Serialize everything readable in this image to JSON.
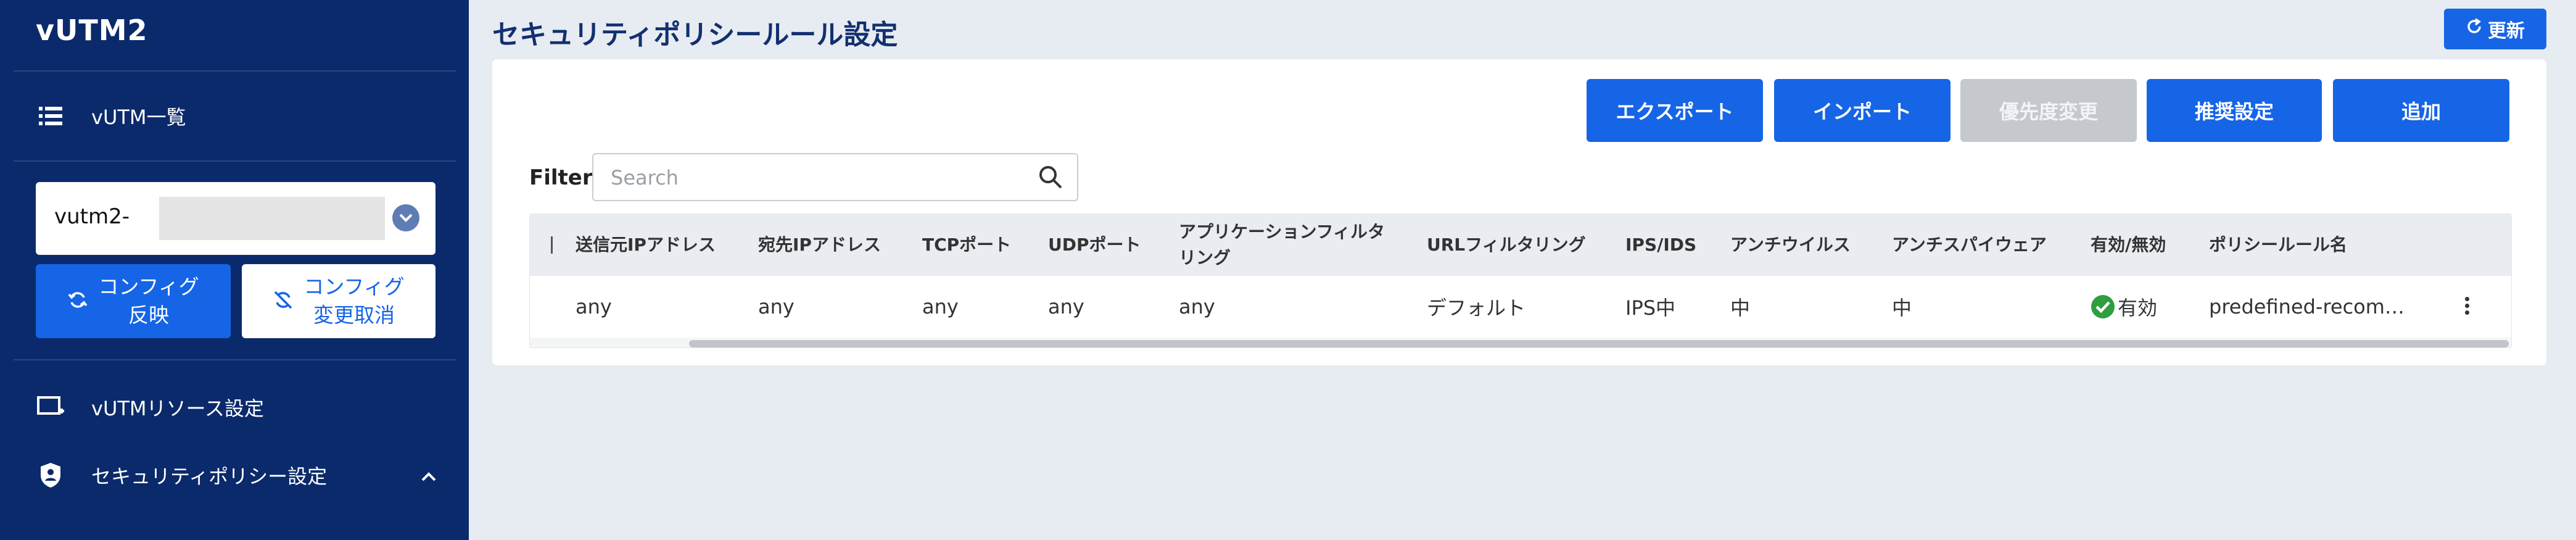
{
  "sidebar": {
    "brand": "vUTM2",
    "items": [
      {
        "label": "vUTM一覧",
        "icon": "list-icon"
      },
      {
        "label": "vUTMリソース設定",
        "icon": "add-screen-icon"
      },
      {
        "label": "セキュリティポリシー設定",
        "icon": "shield-icon"
      }
    ],
    "selector": {
      "value": "vutm2-"
    },
    "apply_button": "コンフィグ\n反映",
    "cancel_button": "コンフィグ\n変更取消"
  },
  "header": {
    "title": "セキュリティポリシールール設定",
    "refresh_label": "更新"
  },
  "toolbar": {
    "export": "エクスポート",
    "import": "インポート",
    "priority": "優先度変更",
    "recommended": "推奨設定",
    "add": "追加"
  },
  "filter": {
    "label": "Filter",
    "placeholder": "Search"
  },
  "table": {
    "columns": [
      "送信元IPアドレス",
      "宛先IPアドレス",
      "TCPポート",
      "UDPポート",
      "アプリケーションフィルタリング",
      "URLフィルタリング",
      "IPS/IDS",
      "アンチウイルス",
      "アンチスパイウェア",
      "有効/無効",
      "ポリシールール名"
    ],
    "rows": [
      {
        "src_ip": "any",
        "dst_ip": "any",
        "tcp": "any",
        "udp": "any",
        "app_filter": "any",
        "url_filter": "デフォルト",
        "ips": "IPS中",
        "antivirus": "中",
        "antispyware": "中",
        "status": "有効",
        "rule_name": "predefined-recom…"
      }
    ]
  },
  "colors": {
    "sidebar_bg": "#0b2a6b",
    "primary": "#1565e6",
    "disabled": "#c5c8cd",
    "status_ok": "#2e9e3f"
  }
}
